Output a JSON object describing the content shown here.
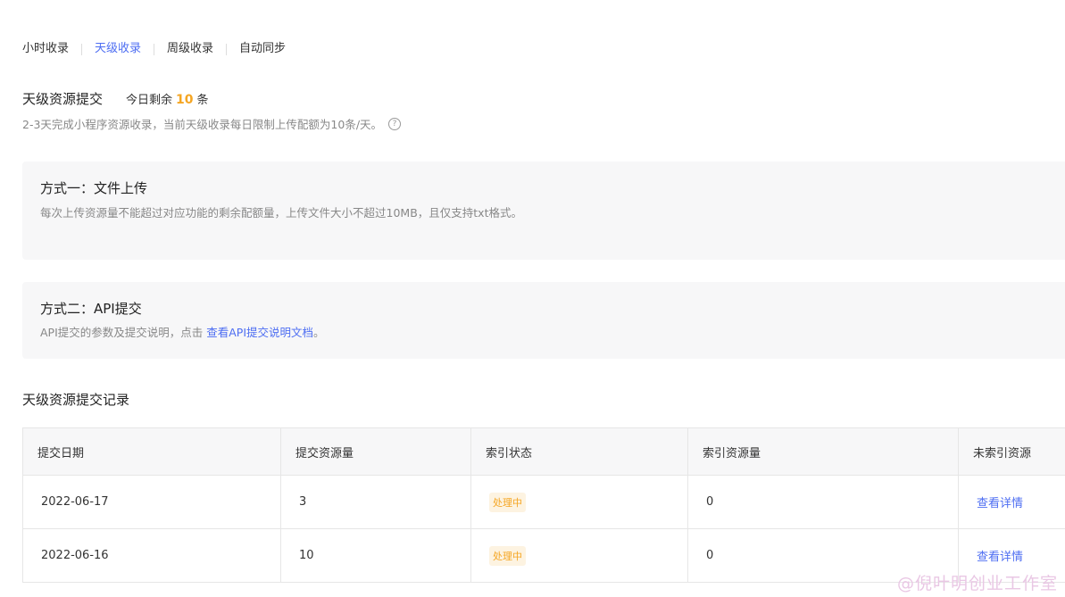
{
  "tabs": [
    {
      "label": "小时收录",
      "active": false
    },
    {
      "label": "天级收录",
      "active": true
    },
    {
      "label": "周级收录",
      "active": false
    },
    {
      "label": "自动同步",
      "active": false
    }
  ],
  "header": {
    "title": "天级资源提交",
    "quota_prefix": "今日剩余",
    "quota_value": "10",
    "quota_suffix": "条",
    "description": "2-3天完成小程序资源收录，当前天级收录每日限制上传配额为10条/天。",
    "help_icon": "question-circle-icon"
  },
  "method1": {
    "title": "方式一：文件上传",
    "description": "每次上传资源量不能超过对应功能的剩余配额量，上传文件大小不超过10MB，且仅支持txt格式。"
  },
  "method2": {
    "title": "方式二：API提交",
    "description_prefix": "API提交的参数及提交说明，点击 ",
    "link_text": "查看API提交说明文档",
    "description_suffix": "。"
  },
  "records": {
    "title": "天级资源提交记录",
    "columns": [
      "提交日期",
      "提交资源量",
      "索引状态",
      "索引资源量",
      "未索引资源"
    ],
    "rows": [
      {
        "date": "2022-06-17",
        "count": "3",
        "status": "处理中",
        "indexed": "0",
        "action": "查看详情"
      },
      {
        "date": "2022-06-16",
        "count": "10",
        "status": "处理中",
        "indexed": "0",
        "action": "查看详情"
      }
    ]
  },
  "watermark": "@倪叶明创业工作室",
  "colors": {
    "accent": "#4e6ef2",
    "highlight": "#f5a623",
    "badge_bg": "#fdf3e1"
  }
}
